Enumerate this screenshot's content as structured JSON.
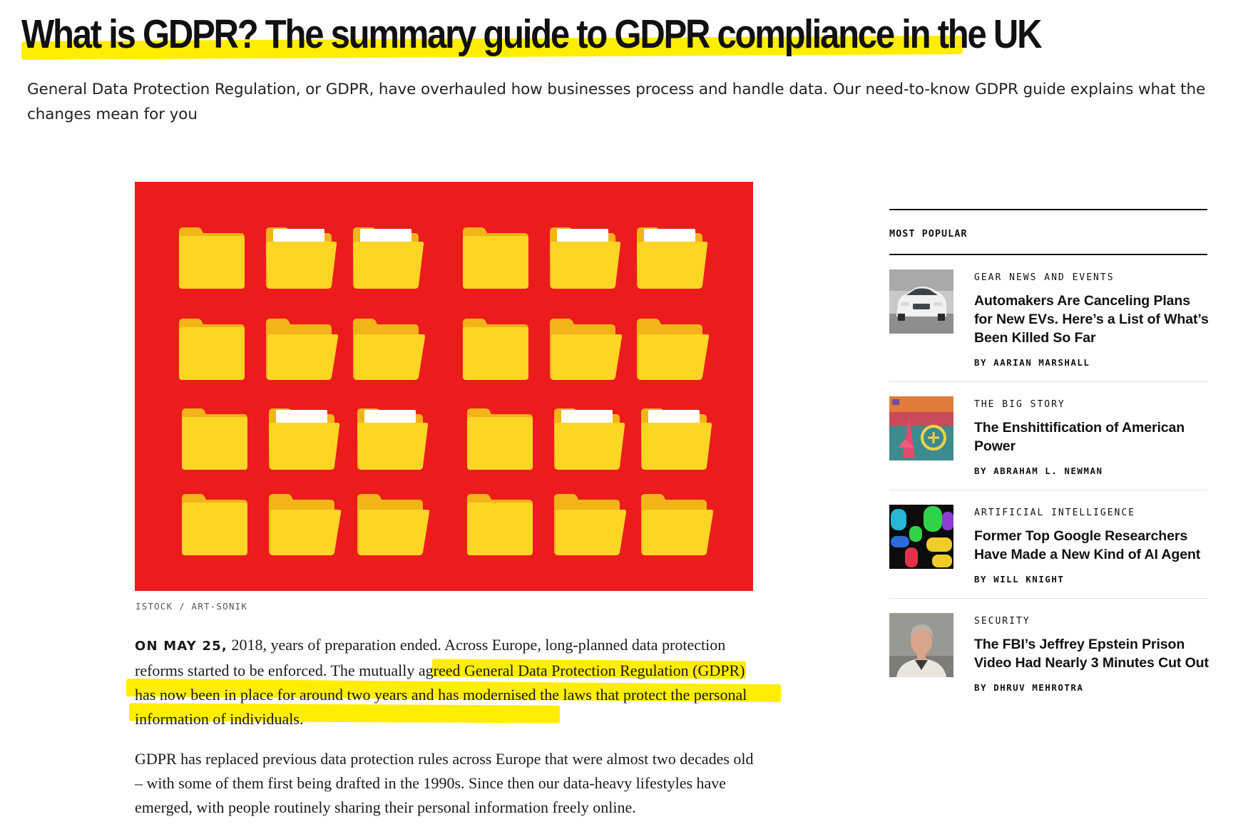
{
  "article": {
    "title": "What is GDPR? The summary guide to GDPR compliance in the UK",
    "subtitle": "General Data Protection Regulation, or GDPR, have overhauled how businesses process and handle data. Our need-to-know GDPR guide explains what the changes mean for you",
    "image_caption": "ISTOCK / ART-SONIK",
    "paragraphs": [
      {
        "lead_in": "ON MAY 25,",
        "text": " 2018, years of preparation ended. Across Europe, long-planned data protection reforms started to be enforced. The mutually agreed General Data Protection Regulation (GDPR) has now been in place for around two years and has modernised the laws that protect the personal information of individuals."
      },
      {
        "text": "GDPR has replaced previous data protection rules across Europe that were almost two decades old – with some of them first being drafted in the 1990s. Since then our data-heavy lifestyles have emerged, with people routinely sharing their personal information freely online."
      }
    ]
  },
  "sidebar": {
    "heading": "MOST POPULAR",
    "stories": [
      {
        "kicker": "GEAR NEWS AND EVENTS",
        "headline": "Automakers Are Canceling Plans for New EVs. Here’s a List of What’s Been Killed So Far",
        "byline": "BY AARIAN MARSHALL"
      },
      {
        "kicker": "THE BIG STORY",
        "headline": "The Enshittification of American Power",
        "byline": "BY ABRAHAM L. NEWMAN"
      },
      {
        "kicker": "ARTIFICIAL INTELLIGENCE",
        "headline": "Former Top Google Researchers Have Made a New Kind of AI Agent",
        "byline": "BY WILL KNIGHT"
      },
      {
        "kicker": "SECURITY",
        "headline": "The FBI’s Jeffrey Epstein Prison Video Had Nearly 3 Minutes Cut Out",
        "byline": "BY DHRUV MEHROTRA"
      }
    ]
  },
  "colors": {
    "highlight": "#ffee00",
    "hero_background": "#ec1c1c",
    "folder": "#fdd524"
  }
}
